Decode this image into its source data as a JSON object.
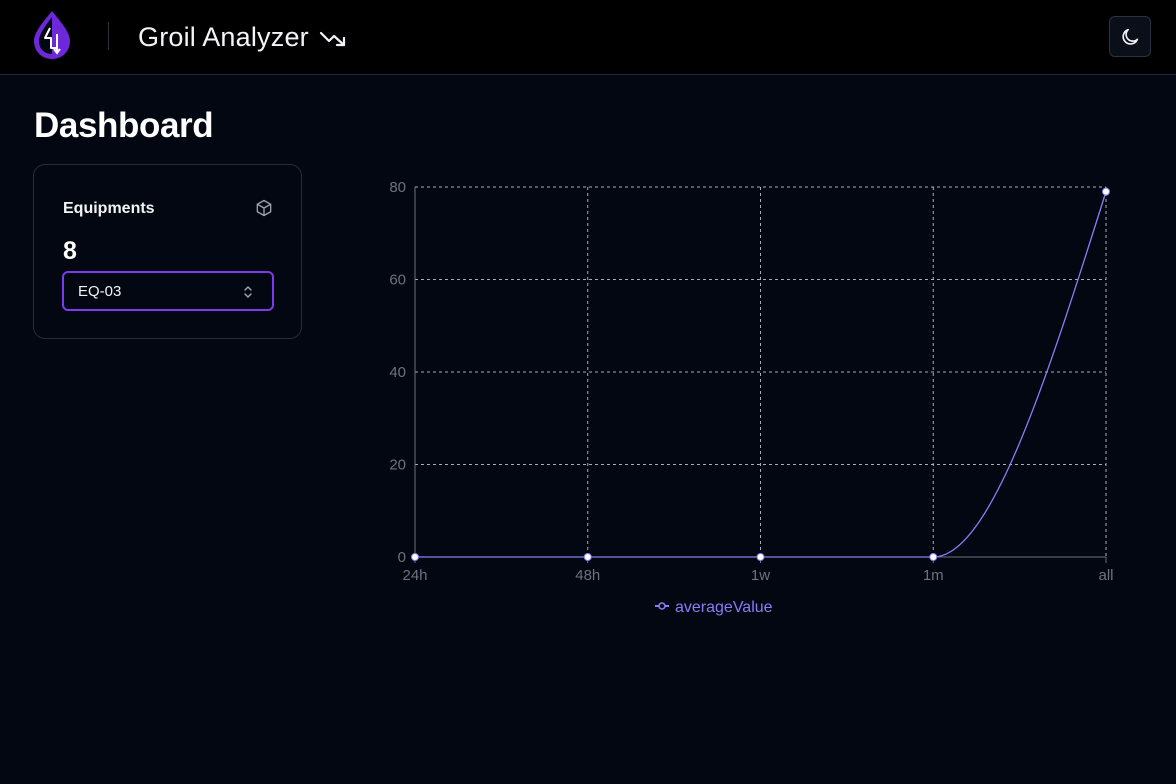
{
  "header": {
    "app_title": "Groil Analyzer",
    "logo_icon": "droplet-lightning-logo",
    "trend_icon": "trending-down-icon",
    "theme_toggle_icon": "moon-icon"
  },
  "main": {
    "page_title": "Dashboard",
    "equipments_card": {
      "title": "Equipments",
      "icon": "box-icon",
      "count": "8",
      "select": {
        "value": "EQ-03",
        "icon": "chevrons-up-down-icon"
      }
    }
  },
  "colors": {
    "accent": "#7c3aed",
    "series": "#8b7cf6",
    "background": "#030712",
    "header": "#000000"
  },
  "chart_data": {
    "type": "line",
    "categories": [
      "24h",
      "48h",
      "1w",
      "1m",
      "all"
    ],
    "series": [
      {
        "name": "averageValue",
        "values": [
          0,
          0,
          0,
          0,
          79
        ]
      }
    ],
    "yticks": [
      "0",
      "20",
      "40",
      "60",
      "80"
    ],
    "ylim": [
      0,
      80
    ],
    "grid": true,
    "legend": "bottom"
  }
}
